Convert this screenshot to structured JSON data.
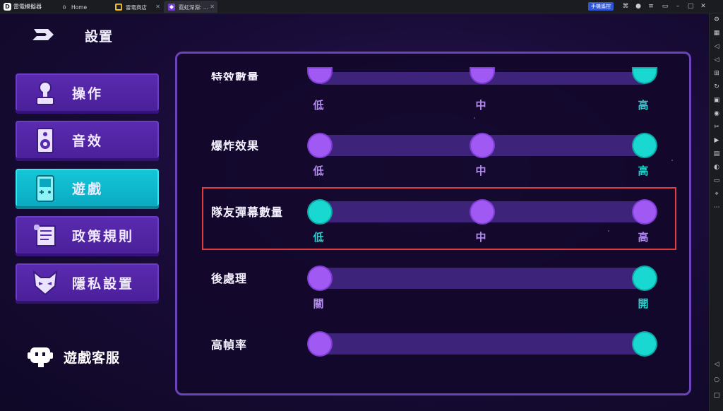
{
  "titlebar": {
    "app_name": "雷電模擬器",
    "tabs": [
      {
        "label": "Home",
        "icon": "home-icon"
      },
      {
        "label": "雷電商店",
        "icon": "store-icon"
      },
      {
        "label": "霓虹深淵: ...",
        "icon": "game-icon"
      }
    ],
    "remote_label": "手機遙控"
  },
  "game": {
    "page_title": "設置",
    "menu": [
      {
        "label": "操作",
        "icon": "joystick-icon",
        "active": false
      },
      {
        "label": "音效",
        "icon": "speaker-icon",
        "active": false
      },
      {
        "label": "遊戲",
        "icon": "gameboy-icon",
        "active": true
      },
      {
        "label": "政策規則",
        "icon": "scroll-icon",
        "active": false
      },
      {
        "label": "隱私設置",
        "icon": "mask-icon",
        "active": false
      }
    ],
    "service_label": "遊戲客服",
    "settings": [
      {
        "label": "特效數量",
        "options": [
          "低",
          "中",
          "高"
        ],
        "selected": "高"
      },
      {
        "label": "爆炸效果",
        "options": [
          "低",
          "中",
          "高"
        ],
        "selected": "高"
      },
      {
        "label": "隊友彈幕數量",
        "options": [
          "低",
          "中",
          "高"
        ],
        "selected": "低"
      },
      {
        "label": "後處理",
        "options": [
          "關",
          "開"
        ],
        "selected": "開"
      },
      {
        "label": "高幀率",
        "options": [],
        "selected": "on"
      }
    ]
  },
  "colors": {
    "accent_cyan": "#19d8d2",
    "accent_purple": "#a059f2",
    "highlight_red": "#e03c3c"
  }
}
